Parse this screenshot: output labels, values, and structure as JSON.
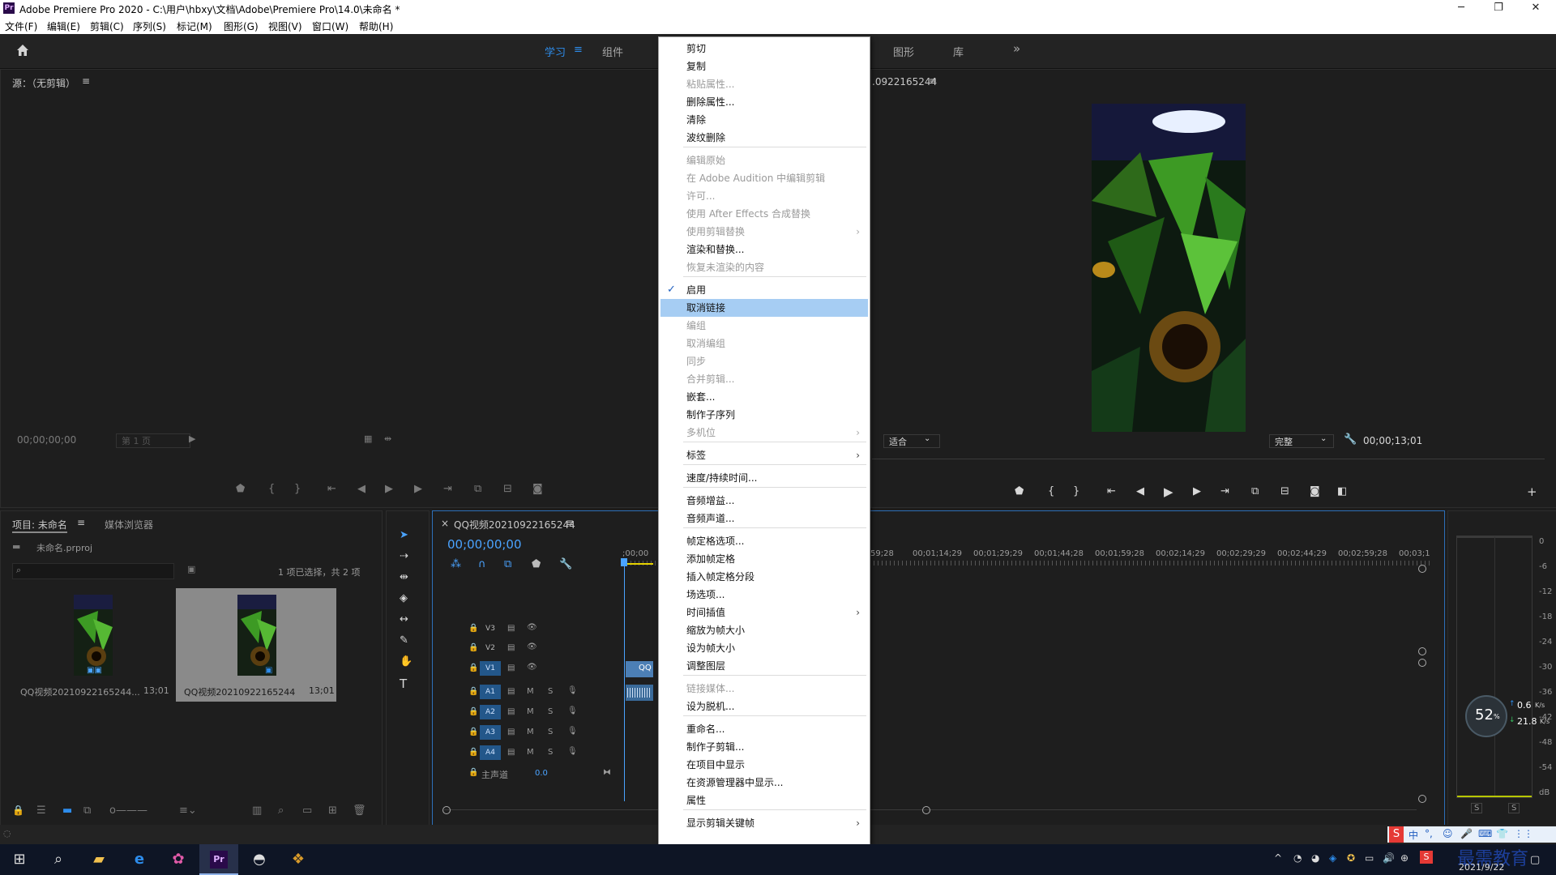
{
  "window": {
    "title": "Adobe Premiere Pro 2020 - C:\\用户\\hbxy\\文档\\Adobe\\Premiere Pro\\14.0\\未命名 *",
    "app_icon": "Pr"
  },
  "menubar": [
    "文件(F)",
    "编辑(E)",
    "剪辑(C)",
    "序列(S)",
    "标记(M)",
    "图形(G)",
    "视图(V)",
    "窗口(W)",
    "帮助(H)"
  ],
  "workspaces": {
    "learn": "学习",
    "assembly": "组件",
    "graphics": "图形",
    "library": "库",
    "more": "»"
  },
  "source_monitor": {
    "title": "源：（无剪辑）",
    "timecode": "00;00;00;00",
    "page_select": "第 1 页"
  },
  "program_monitor": {
    "title_fragment": ".0922165244",
    "fit": "适合",
    "quality": "完整",
    "timecode": "00;00;13;01"
  },
  "project_panel": {
    "tab_project": "项目: 未命名",
    "tab_media": "媒体浏览器",
    "file": "未命名.prproj",
    "selection_info": "1 项已选择，共 2 项",
    "items": [
      {
        "name": "QQ视频20210922165244...",
        "duration": "13;01"
      },
      {
        "name": "QQ视频20210922165244",
        "duration": "13;01"
      }
    ]
  },
  "timeline": {
    "tab": "QQ视频20210922165244",
    "timecode": "00;00;00;00",
    "ruler": [
      ";00;00",
      "59;28",
      "00;01;14;29",
      "00;01;29;29",
      "00;01;44;28",
      "00;01;59;28",
      "00;02;14;29",
      "00;02;29;29",
      "00;02;44;29",
      "00;02;59;28",
      "00;03;1"
    ],
    "video_tracks": [
      "V3",
      "V2",
      "V1"
    ],
    "audio_tracks": [
      "A1",
      "A2",
      "A3",
      "A4"
    ],
    "master_label": "主声道",
    "master_value": "0.0",
    "clip_label": "QQ"
  },
  "audio_meter": {
    "scale": [
      "0",
      "-6",
      "-12",
      "-18",
      "-24",
      "-30",
      "-36",
      "-42",
      "-48",
      "-54",
      "dB"
    ],
    "solo": [
      "S",
      "S"
    ]
  },
  "network_widget": {
    "percent": "52",
    "percent_unit": "%",
    "up": "0.6",
    "up_unit": "K/s",
    "down": "21.8",
    "down_unit": "K/s"
  },
  "context_menu": {
    "groups": [
      [
        {
          "label": "剪切",
          "enabled": true
        },
        {
          "label": "复制",
          "enabled": true
        },
        {
          "label": "粘贴属性...",
          "enabled": false
        },
        {
          "label": "删除属性...",
          "enabled": true
        },
        {
          "label": "清除",
          "enabled": true
        },
        {
          "label": "波纹删除",
          "enabled": true
        }
      ],
      [
        {
          "label": "编辑原始",
          "enabled": false
        },
        {
          "label": "在 Adobe Audition 中编辑剪辑",
          "enabled": false
        },
        {
          "label": "许可...",
          "enabled": false
        },
        {
          "label": "使用 After Effects 合成替换",
          "enabled": false
        },
        {
          "label": "使用剪辑替换",
          "enabled": false,
          "submenu": true
        },
        {
          "label": "渲染和替换...",
          "enabled": true
        },
        {
          "label": "恢复未渲染的内容",
          "enabled": false
        }
      ],
      [
        {
          "label": "启用",
          "enabled": true,
          "checked": true
        },
        {
          "label": "取消链接",
          "enabled": true,
          "highlighted": true
        },
        {
          "label": "编组",
          "enabled": false
        },
        {
          "label": "取消编组",
          "enabled": false
        },
        {
          "label": "同步",
          "enabled": false
        },
        {
          "label": "合并剪辑...",
          "enabled": false
        },
        {
          "label": "嵌套...",
          "enabled": true
        },
        {
          "label": "制作子序列",
          "enabled": true
        },
        {
          "label": "多机位",
          "enabled": false,
          "submenu": true
        }
      ],
      [
        {
          "label": "标签",
          "enabled": true,
          "submenu": true
        }
      ],
      [
        {
          "label": "速度/持续时间...",
          "enabled": true
        }
      ],
      [
        {
          "label": "音频增益...",
          "enabled": true
        },
        {
          "label": "音频声道...",
          "enabled": true
        }
      ],
      [
        {
          "label": "帧定格选项...",
          "enabled": true
        },
        {
          "label": "添加帧定格",
          "enabled": true
        },
        {
          "label": "插入帧定格分段",
          "enabled": true
        },
        {
          "label": "场选项...",
          "enabled": true
        },
        {
          "label": "时间插值",
          "enabled": true,
          "submenu": true
        },
        {
          "label": "缩放为帧大小",
          "enabled": true
        },
        {
          "label": "设为帧大小",
          "enabled": true
        },
        {
          "label": "调整图层",
          "enabled": true
        }
      ],
      [
        {
          "label": "链接媒体...",
          "enabled": false
        },
        {
          "label": "设为脱机...",
          "enabled": true
        }
      ],
      [
        {
          "label": "重命名...",
          "enabled": true
        },
        {
          "label": "制作子剪辑...",
          "enabled": true
        },
        {
          "label": "在项目中显示",
          "enabled": true
        },
        {
          "label": "在资源管理器中显示...",
          "enabled": true
        },
        {
          "label": "属性",
          "enabled": true
        }
      ],
      [
        {
          "label": "显示剪辑关键帧",
          "enabled": true,
          "submenu": true
        }
      ]
    ]
  },
  "ime_bar": [
    "中",
    "°,",
    "☺",
    "🎤",
    "⌨",
    "👕",
    "⋮⋮"
  ],
  "watermark": "最需教育",
  "taskbar": {
    "date": "2021/9/22",
    "icons": [
      "windows-start",
      "search",
      "file-explorer",
      "edge",
      "color-app",
      "premiere-pro",
      "photo-app",
      "pet-app"
    ]
  },
  "colors": {
    "accent_blue": "#2d8ceb",
    "menu_highlight": "#a6cdf3",
    "track_label_blue": "#23578a",
    "playhead": "#4aa3ff"
  }
}
